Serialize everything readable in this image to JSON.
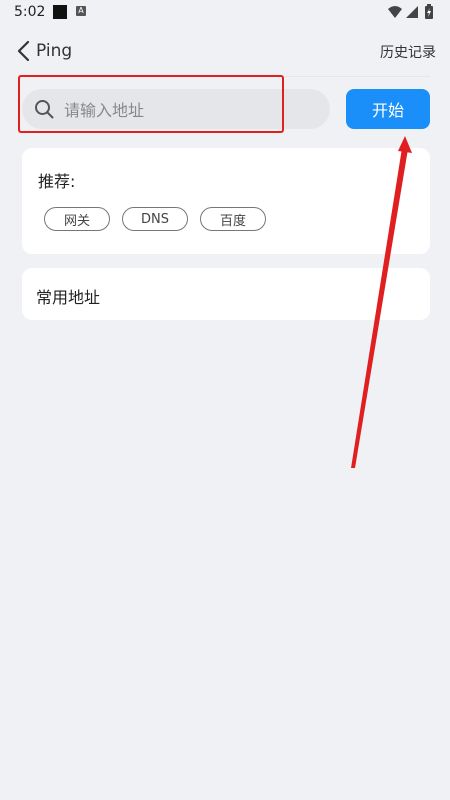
{
  "status_bar": {
    "time": "5:02",
    "a_label": "A"
  },
  "header": {
    "title": "Ping",
    "history_label": "历史记录"
  },
  "search": {
    "placeholder": "请输入地址",
    "value": ""
  },
  "start_button": {
    "label": "开始",
    "color": "#1a8ffa"
  },
  "recommend": {
    "title": "推荐:",
    "tags": [
      "网关",
      "DNS",
      "百度"
    ]
  },
  "common": {
    "title": "常用地址"
  },
  "annotation": {
    "box_color": "#e02020",
    "arrow_color": "#e02020"
  },
  "icons": [
    "back-chevron-icon",
    "search-icon",
    "wifi-icon",
    "signal-icon",
    "battery-icon"
  ]
}
